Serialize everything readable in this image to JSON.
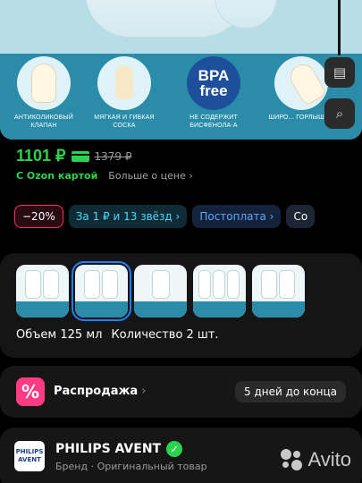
{
  "gallery": {
    "features": [
      {
        "caption": "АНТИКОЛИКОВЫЙ КЛАПАН"
      },
      {
        "caption": "МЯГКАЯ И ГИБКАЯ СОСКА"
      },
      {
        "badge_line1": "BPA",
        "badge_line2": "free",
        "caption": "НЕ СОДЕРЖИТ БИСФЕНОЛА-А"
      },
      {
        "caption": "ШИРО... ГОРЛЫШК..."
      }
    ],
    "side_buttons": [
      "book-icon",
      "search-face-icon"
    ]
  },
  "price": {
    "current": "1101 ₽",
    "old": "1379 ₽",
    "card_label": "С Ozon картой",
    "more_link": "Больше о цене ›"
  },
  "chips": {
    "discount": "−20%",
    "stars": "За 1 ₽ и 13 звёзд ›",
    "postpay": "Постоплата ›",
    "more": "Со"
  },
  "variants": {
    "volume": "Объем 125 мл",
    "quantity": "Количество 2 шт."
  },
  "sale": {
    "icon": "%",
    "title": "Распродажа",
    "chevron": "›",
    "days": "5 дней до конца"
  },
  "brand": {
    "logo_line1": "PHILIPS",
    "logo_line2": "AVENT",
    "name": "PHILIPS AVENT",
    "subtitle": "Бренд · Оригинальный товар",
    "verified": "✓"
  },
  "watermark": {
    "text": "Avito"
  },
  "colors": {
    "price_green": "#2bd34d",
    "sale_pink": "#ff3b84",
    "select_blue": "#1f7fff"
  }
}
